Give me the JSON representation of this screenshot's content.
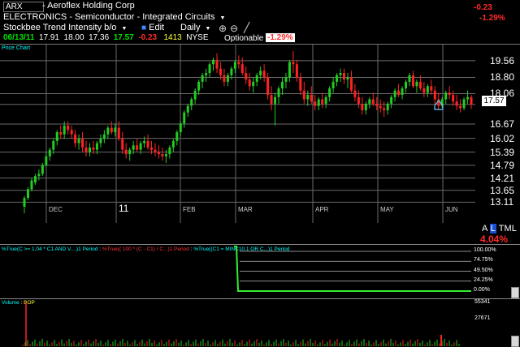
{
  "header": {
    "symbol": "ARX",
    "company": "Aeroflex Holding Corp",
    "sector": "ELECTRONICS",
    "industry_sep": "-",
    "industry": "Semiconductor - Integrated Circuits",
    "change": "-0.23",
    "change_pct": "-1.29%"
  },
  "quote": {
    "date": "06/13/11",
    "open": "17.91",
    "high": "18.00",
    "low": "17.36",
    "close": "17.57",
    "change": "-0.23",
    "volume": "1413",
    "exchange": "NYSE",
    "optionable": "Optionable",
    "pct": "-1.29%"
  },
  "toolbar": {
    "layout": "Stockbee Trend Intensity b/o",
    "edit": "Edit",
    "period": "Daily"
  },
  "price_chart": {
    "label": "Price Chart",
    "y_ticks": [
      "19.56",
      "18.80",
      "18.06",
      "17.57",
      "16.67",
      "16.02",
      "15.39",
      "14.79",
      "14.21",
      "13.65",
      "13.11"
    ],
    "last_price": "17.57",
    "x_ticks": [
      "DEC",
      "11",
      "FEB",
      "MAR",
      "APR",
      "MAY",
      "JUN"
    ],
    "scale_buttons": [
      "A",
      "L",
      "T",
      "M",
      "L"
    ],
    "pct_change": "4.04%",
    "up_color": "#22cc22",
    "down_color": "#ff2222"
  },
  "chart_data": {
    "type": "candlestick",
    "x": [
      "DEC",
      "11",
      "FEB",
      "MAR",
      "APR",
      "MAY",
      "JUN"
    ],
    "ylim": [
      12.9,
      20.0
    ],
    "series": [
      {
        "values": [
          [
            12.9,
            13.4,
            12.6,
            13.3
          ],
          [
            13.3,
            13.8,
            13.2,
            13.7
          ],
          [
            13.7,
            14.2,
            13.6,
            14.1
          ],
          [
            14.0,
            14.4,
            13.9,
            14.3
          ],
          [
            14.3,
            14.6,
            14.1,
            14.4
          ],
          [
            14.4,
            14.9,
            14.3,
            14.8
          ],
          [
            14.8,
            15.4,
            14.7,
            15.2
          ],
          [
            15.2,
            15.6,
            15.0,
            15.5
          ],
          [
            15.5,
            16.0,
            15.3,
            15.9
          ],
          [
            15.9,
            16.4,
            15.7,
            16.3
          ],
          [
            16.3,
            16.6,
            16.0,
            16.2
          ],
          [
            16.2,
            16.8,
            16.0,
            16.6
          ],
          [
            16.6,
            16.8,
            16.2,
            16.4
          ],
          [
            16.4,
            16.6,
            16.0,
            16.2
          ],
          [
            16.2,
            16.4,
            15.6,
            15.8
          ],
          [
            15.8,
            16.2,
            15.5,
            16.0
          ],
          [
            16.0,
            16.3,
            15.4,
            15.6
          ],
          [
            15.6,
            15.9,
            15.2,
            15.4
          ],
          [
            15.4,
            15.8,
            15.2,
            15.6
          ],
          [
            15.6,
            15.9,
            15.3,
            15.5
          ],
          [
            15.5,
            15.9,
            15.3,
            15.8
          ],
          [
            15.8,
            16.2,
            15.6,
            16.0
          ],
          [
            16.0,
            16.4,
            15.8,
            16.2
          ],
          [
            16.2,
            16.6,
            16.0,
            16.5
          ],
          [
            16.5,
            16.8,
            16.2,
            16.3
          ],
          [
            16.3,
            16.7,
            16.1,
            16.5
          ],
          [
            16.5,
            16.8,
            15.9,
            16.0
          ],
          [
            16.0,
            16.3,
            15.3,
            15.5
          ],
          [
            15.5,
            15.8,
            15.1,
            15.3
          ],
          [
            15.3,
            15.6,
            15.0,
            15.5
          ],
          [
            15.5,
            15.9,
            15.3,
            15.7
          ],
          [
            15.7,
            16.0,
            15.4,
            15.5
          ],
          [
            15.5,
            15.9,
            15.3,
            15.8
          ],
          [
            15.8,
            16.1,
            15.6,
            15.9
          ],
          [
            15.9,
            16.2,
            15.5,
            15.6
          ],
          [
            15.6,
            15.9,
            15.3,
            15.5
          ],
          [
            15.5,
            15.8,
            15.2,
            15.4
          ],
          [
            15.4,
            15.7,
            15.1,
            15.3
          ],
          [
            15.3,
            15.6,
            15.0,
            15.2
          ],
          [
            15.2,
            15.5,
            14.9,
            15.3
          ],
          [
            15.3,
            15.7,
            15.1,
            15.6
          ],
          [
            15.6,
            16.0,
            15.4,
            15.9
          ],
          [
            15.9,
            16.4,
            15.7,
            16.3
          ],
          [
            16.3,
            16.8,
            16.1,
            16.7
          ],
          [
            16.7,
            17.3,
            16.5,
            17.2
          ],
          [
            17.2,
            17.6,
            17.0,
            17.5
          ],
          [
            17.5,
            17.9,
            17.3,
            17.8
          ],
          [
            17.8,
            18.3,
            17.6,
            18.2
          ],
          [
            18.2,
            18.7,
            18.0,
            18.6
          ],
          [
            18.6,
            19.0,
            18.3,
            18.9
          ],
          [
            18.9,
            19.2,
            18.6,
            19.0
          ],
          [
            19.0,
            19.5,
            18.8,
            19.4
          ],
          [
            19.4,
            19.7,
            19.1,
            19.6
          ],
          [
            19.6,
            19.9,
            19.0,
            19.2
          ],
          [
            19.2,
            19.5,
            18.7,
            18.9
          ],
          [
            18.9,
            19.2,
            18.4,
            18.6
          ],
          [
            18.6,
            19.0,
            18.4,
            18.9
          ],
          [
            18.9,
            19.3,
            18.7,
            19.2
          ],
          [
            19.2,
            19.6,
            19.0,
            19.5
          ],
          [
            19.5,
            19.8,
            19.2,
            19.4
          ],
          [
            19.4,
            19.7,
            18.9,
            19.0
          ],
          [
            19.0,
            19.3,
            18.5,
            18.7
          ],
          [
            18.7,
            19.0,
            18.2,
            18.4
          ],
          [
            18.4,
            18.8,
            18.1,
            18.6
          ],
          [
            18.6,
            19.0,
            18.4,
            18.9
          ],
          [
            18.9,
            19.3,
            18.7,
            19.1
          ],
          [
            19.1,
            19.4,
            18.6,
            18.8
          ],
          [
            18.8,
            19.0,
            17.8,
            18.0
          ],
          [
            18.0,
            18.4,
            17.3,
            17.6
          ],
          [
            17.6,
            18.1,
            16.6,
            17.9
          ],
          [
            17.9,
            18.4,
            17.6,
            18.3
          ],
          [
            18.3,
            18.8,
            18.0,
            18.6
          ],
          [
            18.6,
            19.0,
            18.3,
            18.8
          ],
          [
            18.8,
            19.6,
            18.6,
            19.5
          ],
          [
            19.5,
            20.0,
            19.0,
            19.4
          ],
          [
            19.4,
            19.6,
            18.6,
            18.8
          ],
          [
            18.8,
            19.0,
            18.0,
            18.2
          ],
          [
            18.2,
            18.6,
            17.6,
            17.8
          ],
          [
            17.8,
            18.2,
            17.5,
            18.0
          ],
          [
            18.0,
            18.4,
            17.6,
            17.7
          ],
          [
            17.7,
            18.0,
            17.3,
            17.5
          ],
          [
            17.5,
            17.9,
            17.3,
            17.8
          ],
          [
            17.8,
            18.1,
            17.4,
            17.6
          ],
          [
            17.6,
            18.0,
            17.4,
            17.9
          ],
          [
            17.9,
            18.4,
            17.7,
            18.3
          ],
          [
            18.3,
            18.8,
            18.1,
            18.6
          ],
          [
            18.6,
            19.0,
            18.4,
            18.9
          ],
          [
            18.9,
            19.2,
            18.6,
            19.0
          ],
          [
            19.0,
            19.2,
            18.5,
            18.7
          ],
          [
            18.7,
            19.0,
            18.3,
            18.8
          ],
          [
            18.8,
            19.1,
            18.1,
            18.2
          ],
          [
            18.2,
            18.5,
            17.7,
            17.9
          ],
          [
            17.9,
            18.2,
            17.4,
            17.6
          ],
          [
            17.6,
            17.9,
            17.1,
            17.3
          ],
          [
            17.3,
            17.7,
            17.1,
            17.6
          ],
          [
            17.6,
            17.9,
            17.4,
            17.8
          ],
          [
            17.8,
            18.1,
            17.5,
            17.6
          ],
          [
            17.6,
            17.9,
            17.3,
            17.5
          ],
          [
            17.5,
            17.8,
            17.2,
            17.4
          ],
          [
            17.4,
            17.7,
            17.0,
            17.3
          ],
          [
            17.3,
            17.7,
            17.1,
            17.6
          ],
          [
            17.6,
            18.0,
            17.4,
            17.9
          ],
          [
            17.9,
            18.3,
            17.7,
            18.2
          ],
          [
            18.2,
            18.5,
            17.9,
            18.0
          ],
          [
            18.0,
            18.4,
            17.8,
            18.3
          ],
          [
            18.3,
            18.7,
            18.1,
            18.6
          ],
          [
            18.6,
            19.0,
            18.4,
            18.9
          ],
          [
            18.9,
            19.1,
            18.3,
            18.4
          ],
          [
            18.4,
            18.7,
            18.1,
            18.6
          ],
          [
            18.6,
            18.9,
            18.2,
            18.3
          ],
          [
            18.3,
            18.6,
            17.9,
            18.1
          ],
          [
            18.1,
            18.5,
            17.9,
            18.4
          ],
          [
            18.4,
            18.7,
            18.0,
            18.2
          ],
          [
            18.2,
            18.4,
            17.6,
            17.8
          ],
          [
            17.8,
            18.1,
            17.3,
            17.5
          ],
          [
            17.5,
            17.9,
            17.4,
            17.8
          ],
          [
            17.8,
            18.2,
            17.6,
            18.1
          ],
          [
            18.1,
            18.4,
            17.8,
            18.0
          ],
          [
            18.0,
            18.2,
            17.5,
            17.7
          ],
          [
            17.7,
            18.0,
            17.3,
            17.5
          ],
          [
            17.5,
            17.8,
            17.2,
            17.4
          ],
          [
            17.4,
            17.9,
            17.3,
            17.8
          ],
          [
            17.8,
            18.2,
            17.6,
            17.9
          ],
          [
            17.9,
            18.0,
            17.36,
            17.57
          ]
        ]
      }
    ]
  },
  "indicator": {
    "label1": "%True(C >= 1.04 * C1 AND V....)1 Period",
    "label2": "%True(( 100 * (C - C1) / C...)1 Period",
    "label3": "%True((C1 = MINC10.1 OR C...)1 Period",
    "y_ticks": [
      "100.00%",
      "74.75%",
      "49.50%",
      "24.25%",
      "0.00%"
    ]
  },
  "volume": {
    "label1": "Volume",
    "label2": "BOP",
    "y_ticks": [
      "55341",
      "27671"
    ]
  }
}
